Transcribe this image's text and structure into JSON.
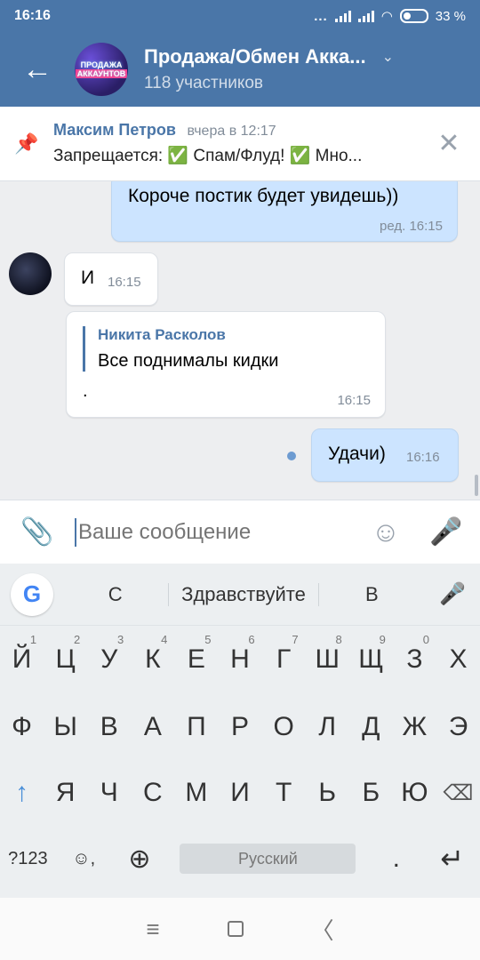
{
  "status_bar": {
    "time": "16:16",
    "dots": "...",
    "battery": "33 %"
  },
  "header": {
    "back_icon": "←",
    "avatar_line1": "ПРОДАЖА",
    "avatar_line2": "АККАУНТОВ",
    "title": "Продажа/Обмен Акка...",
    "chevron": "⌄",
    "subtitle": "118 участников"
  },
  "pinned": {
    "icon": "📌",
    "author": "Максим Петров",
    "time": "вчера в 12:17",
    "text": "Запрещается: ✅ Спам/Флуд! ✅ Мно...",
    "close_icon": "✕"
  },
  "messages": [
    {
      "text": "Короче постик будет увидешь))",
      "time": "ред. 16:15",
      "direction": "out"
    },
    {
      "text": "И",
      "time": "16:15",
      "direction": "in"
    },
    {
      "reply_author": "Никита Расколов",
      "reply_text": "Все поднималы кидки",
      "text": ".",
      "time": "16:15",
      "direction": "in"
    },
    {
      "text": "Удачи)",
      "time": "16:16",
      "direction": "out"
    }
  ],
  "input": {
    "placeholder": "Ваше сообщение",
    "clip_icon": "📎",
    "emoji_icon": "☺",
    "mic_icon": "🎤"
  },
  "keyboard": {
    "g_letter": "G",
    "suggestions": [
      "С",
      "Здравствуйте",
      "В"
    ],
    "suggest_mic": "🎤",
    "row1": [
      {
        "k": "Й",
        "n": "1"
      },
      {
        "k": "Ц",
        "n": "2"
      },
      {
        "k": "У",
        "n": "3"
      },
      {
        "k": "К",
        "n": "4"
      },
      {
        "k": "Е",
        "n": "5"
      },
      {
        "k": "Н",
        "n": "6"
      },
      {
        "k": "Г",
        "n": "7"
      },
      {
        "k": "Ш",
        "n": "8"
      },
      {
        "k": "Щ",
        "n": "9"
      },
      {
        "k": "З",
        "n": "0"
      },
      {
        "k": "Х",
        "n": ""
      }
    ],
    "row2": [
      "Ф",
      "Ы",
      "В",
      "А",
      "П",
      "Р",
      "О",
      "Л",
      "Д",
      "Ж",
      "Э"
    ],
    "row3": [
      "Я",
      "Ч",
      "С",
      "М",
      "И",
      "Т",
      "Ь",
      "Б",
      "Ю"
    ],
    "shift_icon": "↑",
    "backspace_icon": "⌫",
    "symbols_label": "?123",
    "emoji_comma": "☺,",
    "globe_icon": "⊕",
    "space_label": "Русский",
    "period": ".",
    "enter_icon": "↵"
  },
  "nav": {
    "menu_icon": "≡",
    "back_icon": "〈"
  }
}
